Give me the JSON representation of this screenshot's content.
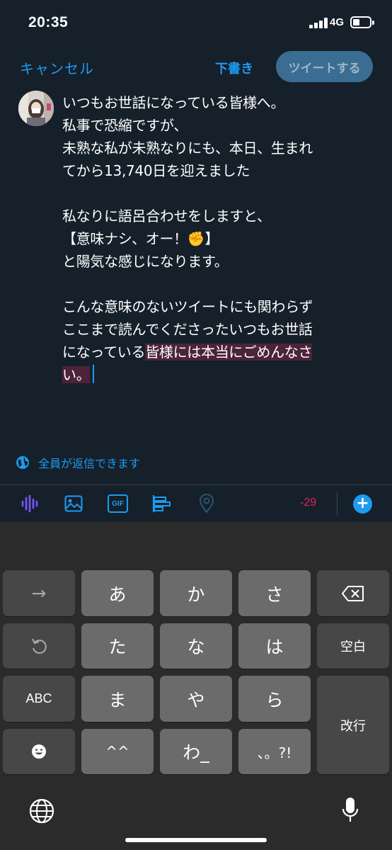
{
  "status": {
    "time": "20:35",
    "network": "4G"
  },
  "header": {
    "cancel_label": "キャンセル",
    "drafts_label": "下書き",
    "tweet_label": "ツイートする"
  },
  "compose": {
    "lines": [
      "いつもお世話になっている皆様へ。",
      "私事で恐縮ですが、",
      "未熟な私が未熟なりにも、本日、生まれ",
      "てから13,740日を迎えました",
      "",
      "私なりに語呂合わせをしますと、",
      "【意味ナシ、オー！✊】",
      "と陽気な感じになります。",
      "",
      "こんな意味のないツイートにも関わらず",
      "ここまで読んでくださったいつもお世話"
    ],
    "line12_plain": "になっている",
    "line12_highlight": "皆様には本当にごめんなさ",
    "line13_highlight": "い。"
  },
  "reply_setting": {
    "label": "全員が返信できます"
  },
  "toolbar": {
    "icons": [
      "audio-wave-icon",
      "image-icon",
      "gif-icon",
      "poll-icon",
      "location-icon"
    ],
    "gif_label": "GIF",
    "char_counter": "-29",
    "add_label": "+"
  },
  "keyboard": {
    "row1": [
      "→",
      "あ",
      "か",
      "さ",
      "⌫"
    ],
    "row2": [
      "↺",
      "た",
      "な",
      "は",
      "空白"
    ],
    "row3": [
      "ABC",
      "ま",
      "や",
      "ら",
      "改行"
    ],
    "row4": [
      "☻",
      "^^",
      "わ_",
      "、。?!"
    ],
    "space_label": "空白",
    "return_label": "改行",
    "abc_label": "ABC"
  },
  "colors": {
    "background": "#15202b",
    "accent": "#1d9bf0",
    "counter": "#e0245e",
    "highlight": "#4c2339"
  }
}
